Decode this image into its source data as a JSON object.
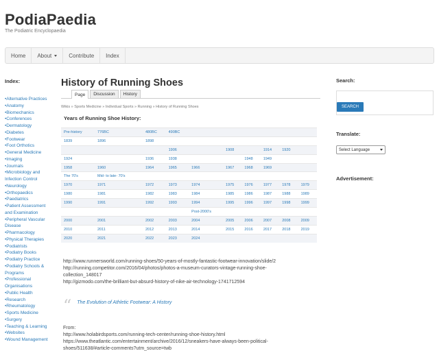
{
  "site": {
    "title": "PodiaPaedia",
    "tagline": "The Podiatric Encyclopaedia"
  },
  "nav": {
    "home": "Home",
    "about": "About",
    "contribute": "Contribute",
    "index": "Index"
  },
  "sidebar_left": {
    "title": "Index:",
    "items": [
      "•Alternative Practices",
      "•Anatomy",
      "•Biomechanics",
      "•Conferences",
      "•Dermatology",
      "•Diabetes",
      "•Footwear",
      "•Foot Orthotics",
      "•General Medicine",
      "•Imaging",
      "•Journals",
      "•Microbiology and Infection Control",
      "•Neurology",
      "•Orthopaedics",
      "•Paediatrics",
      "•Patient Assessment and Examination",
      "•Peripheral Vascular Disease",
      "•Pharmacology",
      "•Physical Therapies",
      "•Podiatrists",
      "•Podiatry Books",
      "•Podiatry Practice",
      "•Podiatry Schools & Programs",
      "•Professional Organisations",
      "•Public Health",
      "•Research",
      "•Rheumatology",
      "•Sports Medicine",
      "•Surgery",
      "•Teaching & Learning",
      "•Websites",
      "•Wound Management"
    ]
  },
  "main": {
    "title": "History of Running Shoes",
    "tabs": [
      "Page",
      "Discussion",
      "History"
    ],
    "breadcrumb": "Wikis » Sports Medicine » Individual Sports » Running » History of Running Shoes",
    "table_title": "Years of Running Shoe History:",
    "rows": [
      [
        "Pre-history",
        "776BC",
        "",
        "480BC",
        "490BC",
        "",
        "",
        "",
        "",
        ""
      ],
      [
        "1839",
        "1896",
        "",
        "1898",
        "",
        "",
        "",
        "",
        "",
        ""
      ],
      [
        "",
        "",
        "",
        "",
        "1906",
        "",
        "1908",
        "",
        "1914",
        "1920"
      ],
      [
        "1924",
        "",
        "",
        "1936",
        "1938",
        "",
        "",
        "1948",
        "1949",
        ""
      ],
      [
        "1958",
        "1960",
        "",
        "1964",
        "1965",
        "1966",
        "1967",
        "1968",
        "1969",
        ""
      ],
      [
        "The 70's",
        "Mid- to late- 70's",
        "",
        "",
        "",
        "",
        "",
        "",
        "",
        ""
      ],
      [
        "1970",
        "1971",
        "",
        "1972",
        "1973",
        "1974",
        "1975",
        "1976",
        "1977",
        "1978",
        "1979"
      ],
      [
        "1980",
        "1981",
        "",
        "1982",
        "1983",
        "1984",
        "1985",
        "1986",
        "1987",
        "1988",
        "1989"
      ],
      [
        "1990",
        "1991",
        "",
        "1992",
        "1993",
        "1994",
        "1995",
        "1996",
        "1997",
        "1998",
        "1999"
      ],
      [
        "",
        "",
        "",
        "",
        "",
        "Post-2000's",
        "",
        "",
        "",
        "",
        ""
      ],
      [
        "2000",
        "2001",
        "",
        "2002",
        "2003",
        "2004",
        "2005",
        "2006",
        "2007",
        "2008",
        "2009"
      ],
      [
        "2010",
        "2011",
        "",
        "2012",
        "2013",
        "2014",
        "2015",
        "2016",
        "2017",
        "2018",
        "2019"
      ],
      [
        "2020",
        "2021",
        "",
        "2022",
        "2023",
        "2024",
        "",
        "",
        "",
        "",
        ""
      ]
    ],
    "urls": [
      "http://www.runnersworld.com/running-shoes/50-years-of-mostly-fantastic-footwear-innovation/slide/2",
      "http://running.competitor.com/2016/04/photos/photos-a-museum-curators-vintage-running-shoe-collection_148017",
      "http://gizmodo.com/the-brilliant-but-absurd-history-of-nike-air-technology-1741712594"
    ],
    "quote": "The Evolution of Athletic Footwear: A History",
    "from_label": "From:",
    "from_urls": [
      "http://www.holabirdsports.com/running-tech-center/running-shoe-history.html",
      "https://www.theatlantic.com/entertainment/archive/2016/12/sneakers-have-always-been-political-shoes/511638/#article-comments?utm_source=twb"
    ]
  },
  "sidebar_right": {
    "search_title": "Search:",
    "search_button": "SEARCH",
    "translate_title": "Translate:",
    "language_select": "Select Language",
    "ad_title": "Advertisement:"
  }
}
